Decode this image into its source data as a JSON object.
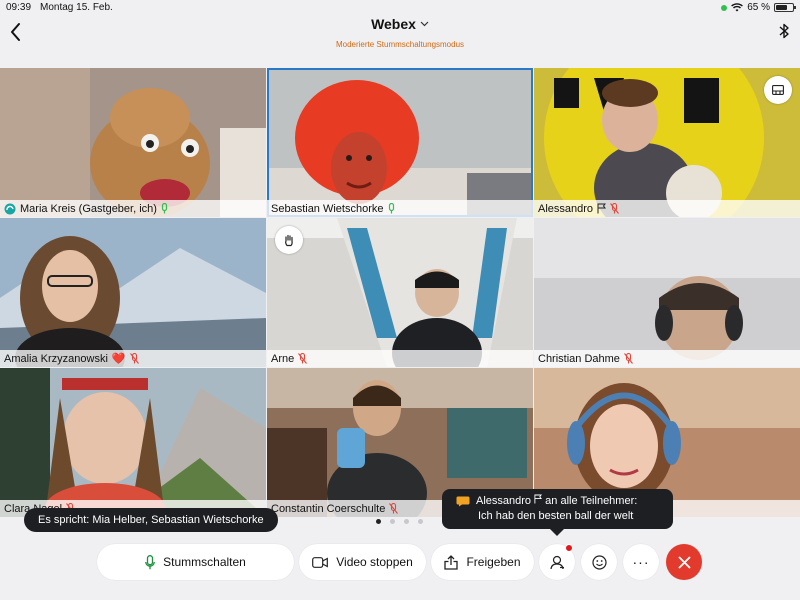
{
  "status": {
    "time": "09:39",
    "date": "Montag 15. Feb.",
    "battery": "65 %",
    "battery_level": 0.65
  },
  "header": {
    "title": "Webex",
    "subtitle": "Moderierte Stummschaltungsmodus"
  },
  "participants": [
    {
      "name": "Maria Kreis (Gastgeber, ich)",
      "mic": "on"
    },
    {
      "name": "Sebastian Wietschorke",
      "mic": "on",
      "active": true
    },
    {
      "name": "Alessandro",
      "mic": "off"
    },
    {
      "name": "Amalia Krzyzanowski",
      "emoji": "❤️",
      "mic": "off"
    },
    {
      "name": "Arne",
      "mic": "off"
    },
    {
      "name": "Christian Dahme",
      "mic": "off"
    },
    {
      "name": "Clara Nagel",
      "mic": "off"
    },
    {
      "name": "Constantin Coerschulte",
      "mic": "off"
    },
    {
      "name": "",
      "mic": "off"
    }
  ],
  "pager": {
    "pages": 4,
    "current": 1
  },
  "speaking": {
    "text": "Es spricht: Mia Helber, Sebastian Wietschorke"
  },
  "chat_toast": {
    "sender": "Alessandro",
    "suffix": " an alle Teilnehmer:",
    "message": "Ich hab den besten ball der welt"
  },
  "controls": {
    "mute": "Stummschalten",
    "video": "Video stoppen",
    "share": "Freigeben",
    "more": "···"
  },
  "colors": {
    "accent": "#2a79c9",
    "end_call": "#e23b2e",
    "mic_on": "#30c04f",
    "mic_off": "#e0463a",
    "subtitle": "#d06a12"
  }
}
